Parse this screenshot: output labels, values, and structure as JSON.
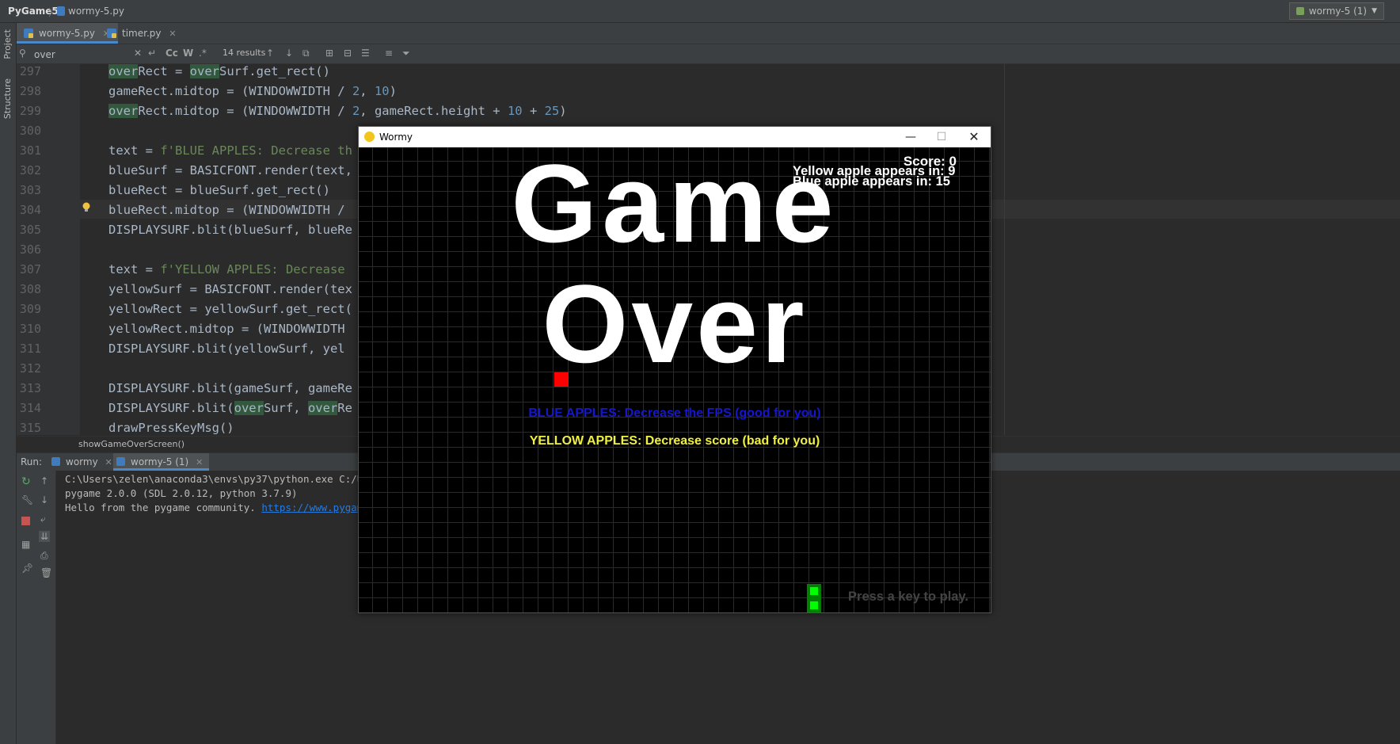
{
  "navbar": {
    "project": "PyGame5",
    "sep": "〉",
    "file": "wormy-5.py",
    "run_config": "wormy-5 (1)"
  },
  "left_strip": {
    "project": "Project",
    "structure": "Structure"
  },
  "tabs": [
    {
      "label": "wormy-5.py"
    },
    {
      "label": "timer.py"
    }
  ],
  "search": {
    "query": "over",
    "results": "14 results",
    "cc": "Cc",
    "w": "W",
    "regex": ".*"
  },
  "editor": {
    "lines": [
      297,
      298,
      299,
      300,
      301,
      302,
      303,
      304,
      305,
      306,
      307,
      308,
      309,
      310,
      311,
      312,
      313,
      314,
      315
    ],
    "code": {
      "l297a": "over",
      "l297b": "Rect = ",
      "l297c": "over",
      "l297d": "Surf.get_rect()",
      "l298a": "gameRect.midtop = (WINDOWWIDTH / ",
      "l298b": "2",
      "l298c": ", ",
      "l298d": "10",
      "l298e": ")",
      "l299a": "over",
      "l299b": "Rect.midtop = (WINDOWWIDTH / ",
      "l299c": "2",
      "l299d": ", gameRect.height + ",
      "l299e": "10",
      "l299f": " + ",
      "l299g": "25",
      "l299h": ")",
      "l301a": "text = ",
      "l301b": "f'BLUE APPLES: Decrease th",
      "l302": "blueSurf = BASICFONT.render(text,",
      "l303": "blueRect = blueSurf.get_rect()",
      "l304": "blueRect.midtop = (WINDOWWIDTH /",
      "l305": "DISPLAYSURF.blit(blueSurf, blueRe",
      "l307a": "text = ",
      "l307b": "f'YELLOW APPLES: Decrease",
      "l308": "yellowSurf = BASICFONT.render(tex",
      "l309": "yellowRect = yellowSurf.get_rect(",
      "l310": "yellowRect.midtop = (WINDOWWIDTH",
      "l311": "DISPLAYSURF.blit(yellowSurf, yel",
      "l313": "DISPLAYSURF.blit(gameSurf, gameRe",
      "l314a": "DISPLAYSURF.blit(",
      "l314b": "over",
      "l314c": "Surf, ",
      "l314d": "over",
      "l314e": "Re",
      "l315": "drawPressKeyMsg()"
    },
    "breadcrumb": "showGameOverScreen()"
  },
  "run": {
    "label": "Run:",
    "tabs": [
      {
        "label": "wormy"
      },
      {
        "label": "wormy-5 (1)"
      }
    ],
    "console": {
      "line1": "C:\\Users\\zelen\\anaconda3\\envs\\py37\\python.exe C:/Use",
      "line2": "pygame 2.0.0 (SDL 2.0.12, python 3.7.9)",
      "line3_text": "Hello from the pygame community. ",
      "line3_link": "https://www.pygame."
    }
  },
  "game_window": {
    "title": "Wormy",
    "score": "Score: 0",
    "yellow_timer": "Yellow apple appears in: 9",
    "blue_timer": "Blue apple appears in: 15",
    "game_text": "Game",
    "over_text": "Over",
    "blue_msg": "BLUE APPLES: Decrease the FPS (good for you)",
    "yellow_msg": "YELLOW APPLES: Decrease score (bad for you)",
    "press_key": "Press a key to play.",
    "colors": {
      "blue_msg": "#1616cc",
      "yellow_msg": "#f0f040",
      "apple": "#ff0000",
      "worm": "#00ff00",
      "worm_dark": "#008000"
    }
  }
}
